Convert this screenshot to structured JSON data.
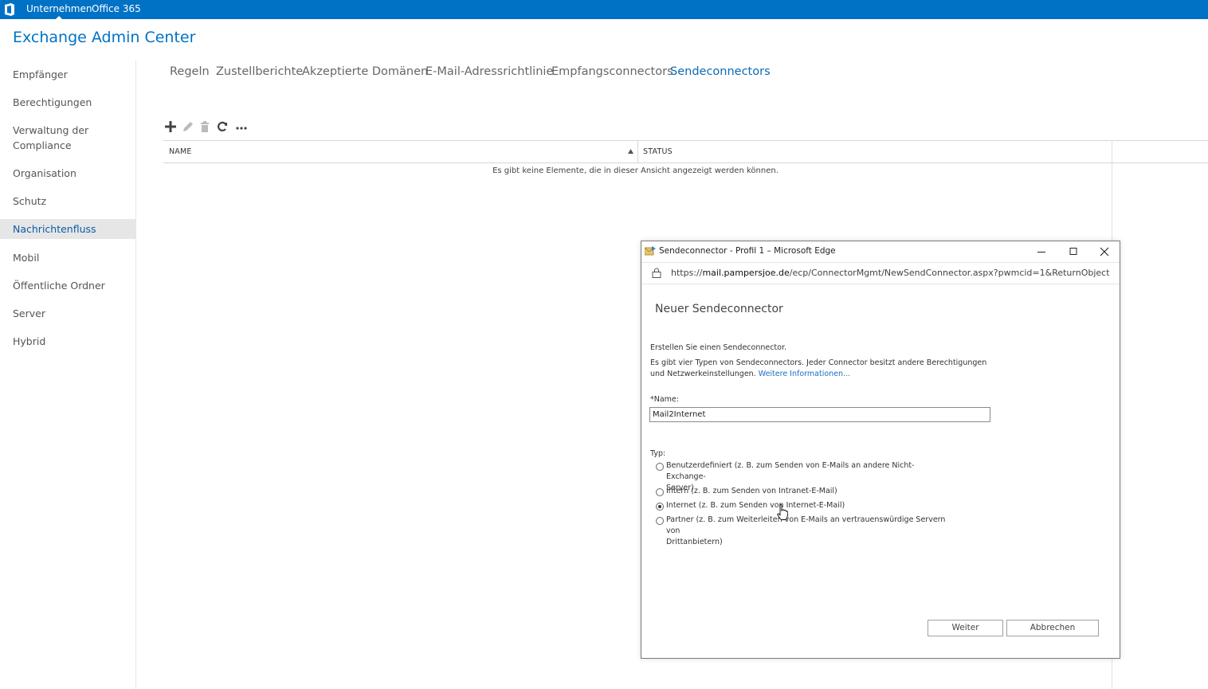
{
  "topbar": {
    "tabs": [
      "Unternehmen",
      "Office 365"
    ],
    "active": "Unternehmen"
  },
  "app_title": "Exchange Admin Center",
  "nav": {
    "items": [
      "Empfänger",
      "Berechtigungen",
      "Verwaltung der Compliance",
      "Organisation",
      "Schutz",
      "Nachrichtenfluss",
      "Mobil",
      "Öffentliche Ordner",
      "Server",
      "Hybrid"
    ],
    "selected": "Nachrichtenfluss"
  },
  "tabs": {
    "items": [
      "Regeln",
      "Zustellberichte",
      "Akzeptierte Domänen",
      "E-Mail-Adressrichtlinie",
      "Empfangsconnectors",
      "Sendeconnectors"
    ],
    "active": "Sendeconnectors"
  },
  "toolbar": {
    "icons": [
      "add-icon",
      "edit-icon",
      "delete-icon",
      "refresh-icon",
      "more-icon"
    ]
  },
  "grid": {
    "columns": [
      "NAME",
      "STATUS"
    ],
    "empty_message": "Es gibt keine Elemente, die in dieser Ansicht angezeigt werden können."
  },
  "dialog": {
    "window_title": "Sendeconnector - Profil 1 – Microsoft Edge",
    "url_prefix": "https://",
    "url_host": "mail.pampersjoe.de",
    "url_path": "/ecp/ConnectorMgmt/NewSendConnector.aspx?pwmcid=1&ReturnObject...",
    "heading": "Neuer Sendeconnector",
    "intro": "Erstellen Sie einen Sendeconnector.",
    "description_line1": "Es gibt vier Typen von Sendeconnectors. Jeder Connector besitzt andere Berechtigungen",
    "description_line2": "und Netzwerkeinstellungen.",
    "more_info_link": "Weitere Informationen...",
    "name_label": "*Name:",
    "name_value": "Mail2Internet",
    "type_label": "Typ:",
    "type_options": [
      {
        "line1": "Benutzerdefiniert (z. B. zum Senden von E-Mails an andere Nicht-Exchange-",
        "line2": "Server)",
        "checked": false
      },
      {
        "line1": "Intern (z. B. zum Senden von Intranet-E-Mail)",
        "line2": "",
        "checked": false
      },
      {
        "line1": "Internet (z. B. zum Senden von Internet-E-Mail)",
        "line2": "",
        "checked": true
      },
      {
        "line1": "Partner (z. B. zum Weiterleiten von E-Mails an vertrauenswürdige Servern von",
        "line2": "Drittanbietern)",
        "checked": false
      }
    ],
    "next_button": "Weiter",
    "cancel_button": "Abbrechen"
  },
  "colors": {
    "topbar": "#0072c6",
    "accent": "#0b6ab7",
    "nav_selected_bg": "#e6e6e6"
  }
}
